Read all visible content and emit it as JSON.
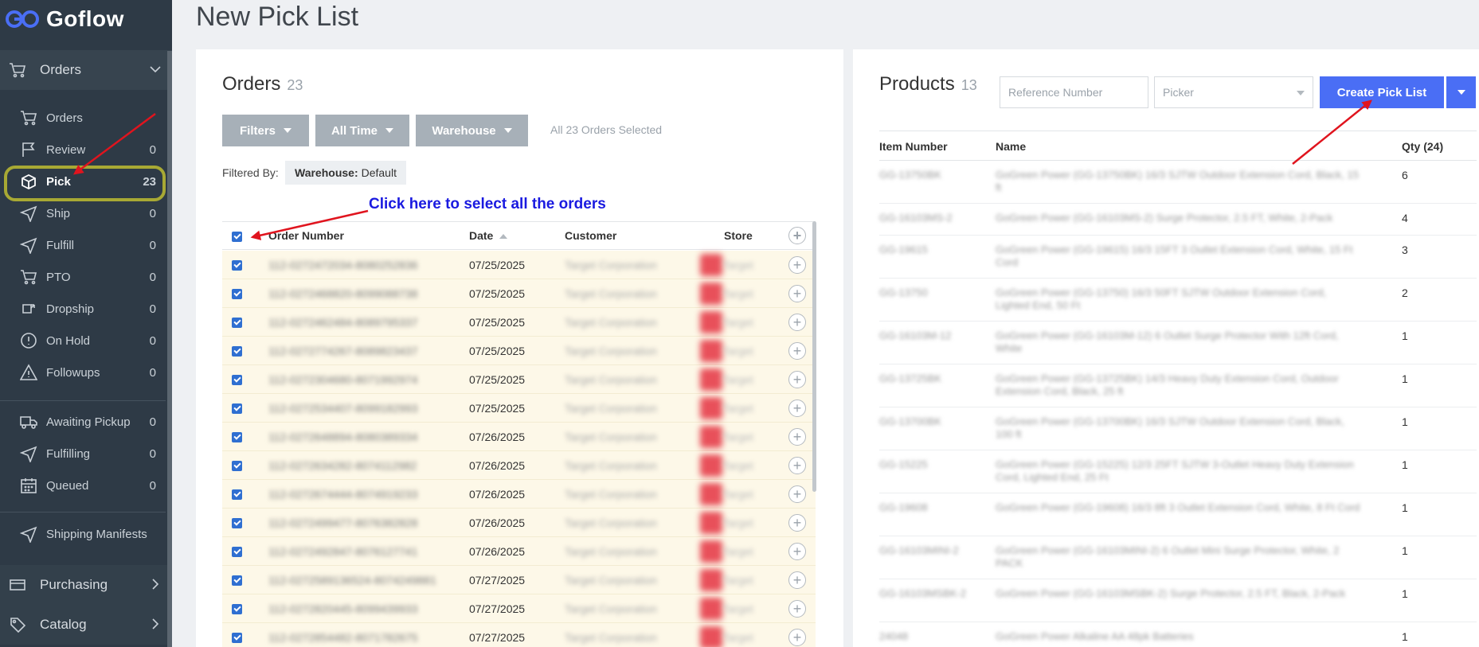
{
  "app": {
    "name": "Goflow"
  },
  "sidebar": {
    "orders_section": "Orders",
    "items": [
      {
        "label": "Orders",
        "count": "",
        "icon": "cart-icon"
      },
      {
        "label": "Review",
        "count": "0",
        "icon": "flag-icon"
      },
      {
        "label": "Pick",
        "count": "23",
        "icon": "box-icon"
      },
      {
        "label": "Ship",
        "count": "0",
        "icon": "send-icon"
      },
      {
        "label": "Fulfill",
        "count": "0",
        "icon": "send-icon"
      },
      {
        "label": "PTO",
        "count": "0",
        "icon": "cart-icon"
      },
      {
        "label": "Dropship",
        "count": "0",
        "icon": "dropship-icon"
      },
      {
        "label": "On Hold",
        "count": "0",
        "icon": "alert-circle-icon"
      },
      {
        "label": "Followups",
        "count": "0",
        "icon": "warning-icon"
      },
      {
        "label": "Awaiting Pickup",
        "count": "0",
        "icon": "truck-icon"
      },
      {
        "label": "Fulfilling",
        "count": "0",
        "icon": "send-icon"
      },
      {
        "label": "Queued",
        "count": "0",
        "icon": "calendar-icon"
      },
      {
        "label": "Shipping Manifests",
        "count": "",
        "icon": "send-icon"
      }
    ],
    "purchasing": "Purchasing",
    "catalog": "Catalog"
  },
  "page": {
    "title": "New Pick List"
  },
  "orders_panel": {
    "title": "Orders",
    "count": "23",
    "filters": [
      "Filters",
      "All Time",
      "Warehouse"
    ],
    "selected_text": "All 23 Orders Selected",
    "filtered_by_label": "Filtered By:",
    "tag_key": "Warehouse:",
    "tag_value": "Default",
    "annotation": "Click here to select all the orders",
    "columns": {
      "order_number": "Order Number",
      "date": "Date",
      "customer": "Customer",
      "store": "Store"
    },
    "rows": [
      {
        "order": "112-0272472034-8080252836",
        "date": "07/25/2025",
        "customer": "Target Corporation",
        "store": "Target"
      },
      {
        "order": "112-0272468820-8099088738",
        "date": "07/25/2025",
        "customer": "Target Corporation",
        "store": "Target"
      },
      {
        "order": "112-0272462484-8089795337",
        "date": "07/25/2025",
        "customer": "Target Corporation",
        "store": "Target"
      },
      {
        "order": "112-0272774267-8089823437",
        "date": "07/25/2025",
        "customer": "Target Corporation",
        "store": "Target"
      },
      {
        "order": "112-0272304680-8071992974",
        "date": "07/25/2025",
        "customer": "Target Corporation",
        "store": "Target"
      },
      {
        "order": "112-0272534407-8099182993",
        "date": "07/25/2025",
        "customer": "Target Corporation",
        "store": "Target"
      },
      {
        "order": "112-0272648894-8080389334",
        "date": "07/26/2025",
        "customer": "Target Corporation",
        "store": "Target"
      },
      {
        "order": "112-0272634282-8074112982",
        "date": "07/26/2025",
        "customer": "Target Corporation",
        "store": "Target"
      },
      {
        "order": "112-0272674444-8074919233",
        "date": "07/26/2025",
        "customer": "Target Corporation",
        "store": "Target"
      },
      {
        "order": "112-0272499477-8076382828",
        "date": "07/26/2025",
        "customer": "Target Corporation",
        "store": "Target"
      },
      {
        "order": "112-0272492847-8076127741",
        "date": "07/26/2025",
        "customer": "Target Corporation",
        "store": "Target"
      },
      {
        "order": "112-0272589136524-8074249881",
        "date": "07/27/2025",
        "customer": "Target Corporation",
        "store": "Target"
      },
      {
        "order": "112-0272820445-8099439933",
        "date": "07/27/2025",
        "customer": "Target Corporation",
        "store": "Target"
      },
      {
        "order": "112-0272854482-8071782675",
        "date": "07/27/2025",
        "customer": "Target Corporation",
        "store": "Target"
      }
    ]
  },
  "products_panel": {
    "title": "Products",
    "count": "13",
    "reference_placeholder": "Reference Number",
    "picker_placeholder": "Picker",
    "create_button": "Create Pick List",
    "columns": {
      "item": "Item Number",
      "name": "Name",
      "qty": "Qty (24)"
    },
    "rows": [
      {
        "item": "GG-13750BK",
        "name": "GoGreen Power (GG-13750BK) 16/3 SJTW Outdoor Extension Cord, Black, 15 ft",
        "qty": "6"
      },
      {
        "item": "GG-16103MS-2",
        "name": "GoGreen Power (GG-16103MS-2) Surge Protector, 2.5 FT, White, 2-Pack",
        "qty": "4"
      },
      {
        "item": "GG-19615",
        "name": "GoGreen Power (GG-19615) 16/3 15FT 3 Outlet Extension Cord, White, 15 Ft Cord",
        "qty": "3"
      },
      {
        "item": "GG-13750",
        "name": "GoGreen Power (GG-13750) 16/3 50FT SJTW Outdoor Extension Cord, Lighted End, 50 Ft",
        "qty": "2"
      },
      {
        "item": "GG-16103M-12",
        "name": "GoGreen Power (GG-16103M-12) 6 Outlet Surge Protector With 12ft Cord, White",
        "qty": "1"
      },
      {
        "item": "GG-13725BK",
        "name": "GoGreen Power (GG-13725BK) 14/3 Heavy Duty Extension Cord, Outdoor Extension Cord, Black, 25 ft",
        "qty": "1"
      },
      {
        "item": "GG-13700BK",
        "name": "GoGreen Power (GG-13700BK) 16/3 SJTW Outdoor Extension Cord, Black, 100 ft",
        "qty": "1"
      },
      {
        "item": "GG-15225",
        "name": "GoGreen Power (GG-15225) 12/3 25FT SJTW 3-Outlet Heavy Duty Extension Cord, Lighted End, 25 Ft",
        "qty": "1"
      },
      {
        "item": "GG-19608",
        "name": "GoGreen Power (GG-19608) 16/3 8ft 3 Outlet Extension Cord, White, 8 Ft Cord",
        "qty": "1"
      },
      {
        "item": "GG-16103MINI-2",
        "name": "GoGreen Power (GG-16103MINI-2) 6 Outlet Mini Surge Protector, White, 2 PACK",
        "qty": "1"
      },
      {
        "item": "GG-16103MSBK-2",
        "name": "GoGreen Power (GG-16103MSBK-2) Surge Protector, 2.5 FT, Black, 2-Pack",
        "qty": "1"
      },
      {
        "item": "24048",
        "name": "GoGreen Power Alkaline AA 48pk Batteries",
        "qty": "1"
      }
    ]
  },
  "colors": {
    "sidebar_bg": "#2e3a46",
    "accent": "#4a6ef5",
    "highlight": "#a8a934",
    "annotation": "#1a1ae0",
    "arrow": "#e0141e"
  }
}
